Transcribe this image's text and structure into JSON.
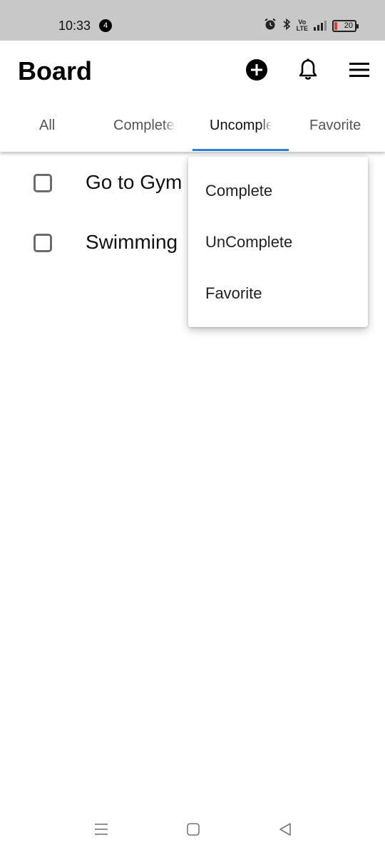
{
  "status_bar": {
    "time": "10:33",
    "notification_count": "4",
    "battery_level": "20",
    "network_label": "Vo LTE"
  },
  "app_bar": {
    "title": "Board",
    "icons": [
      "add-circle-icon",
      "bell-icon",
      "hamburger-menu-icon"
    ]
  },
  "tabs": {
    "items": [
      {
        "label": "All"
      },
      {
        "label": "Complete"
      },
      {
        "label": "Uncomplete"
      },
      {
        "label": "Favorite"
      }
    ],
    "selected": "Uncomplete",
    "indicator_color": "#2e7ed6"
  },
  "tasks": [
    {
      "label": "Go to Gym",
      "checked": false
    },
    {
      "label": "Swimming",
      "checked": false
    }
  ],
  "popup_menu": {
    "items": [
      {
        "label": "Complete"
      },
      {
        "label": "UnComplete"
      },
      {
        "label": "Favorite"
      }
    ]
  },
  "nav_bar": {
    "icons": [
      "recent-apps-icon",
      "home-icon",
      "back-icon"
    ]
  }
}
